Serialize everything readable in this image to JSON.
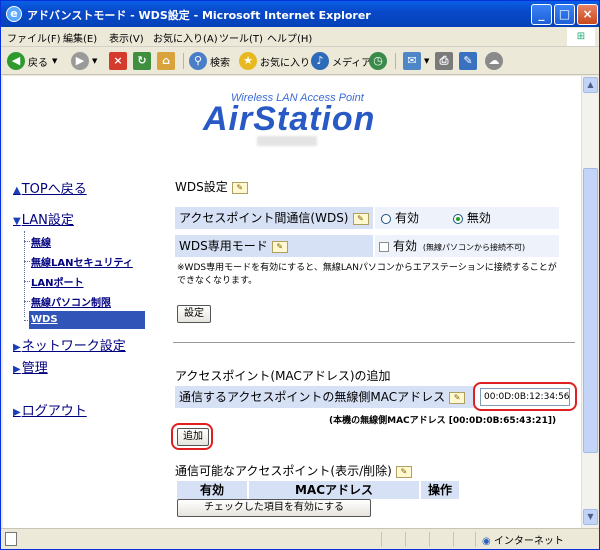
{
  "window": {
    "title": "アドバンストモード - WDS設定 - Microsoft Internet Explorer",
    "controls": {
      "minimize": "_",
      "maximize": "□",
      "close": "×"
    }
  },
  "menu": [
    "ファイル(F)",
    "編集(E)",
    "表示(V)",
    "お気に入り(A)",
    "ツール(T)",
    "ヘルプ(H)"
  ],
  "toolbar": {
    "back": "戻る",
    "search": "検索",
    "favorites": "お気に入り",
    "media": "メディア"
  },
  "logo": {
    "tagline": "Wireless LAN Access Point",
    "brand": "AirStation"
  },
  "nav": {
    "top": "TOPへ戻る",
    "lan": "LAN設定",
    "lan_items": [
      "無線",
      "無線LANセキュリティ",
      "LANポート",
      "無線パソコン制限",
      "WDS"
    ],
    "network": "ネットワーク設定",
    "admin": "管理",
    "logout": "ログアウト"
  },
  "wds": {
    "heading": "WDS設定",
    "ap_comm_label": "アクセスポイント間通信(WDS)",
    "ap_comm_enabled": "有効",
    "ap_comm_disabled": "無効",
    "ap_comm_value": "無効",
    "dedicated_label": "WDS専用モード",
    "dedicated_option": "有効",
    "dedicated_hint": "(無線パソコンから接続不可)",
    "note": "※WDS専用モードを有効にすると、無線LANパソコンからエアステーションに接続することができなくなります。",
    "set_button": "設定"
  },
  "add_ap": {
    "heading": "アクセスポイント(MACアドレス)の追加",
    "field_label": "通信するアクセスポイントの無線側MACアドレス",
    "field_value": "00:0D:0B:12:34:56",
    "own_mac_note": "(本機の無線側MACアドレス [00:0D:0B:65:43:21])",
    "add_button": "追加"
  },
  "ap_list": {
    "heading": "通信可能なアクセスポイント(表示/削除)",
    "columns": [
      "有効",
      "MACアドレス",
      "操作"
    ],
    "enable_button": "チェックした項目を有効にする"
  },
  "status": {
    "zone": "インターネット"
  },
  "colors": {
    "highlight_ring": "#e02020",
    "nav_active": "#3154b8",
    "label_bg": "#d7e1f5"
  }
}
